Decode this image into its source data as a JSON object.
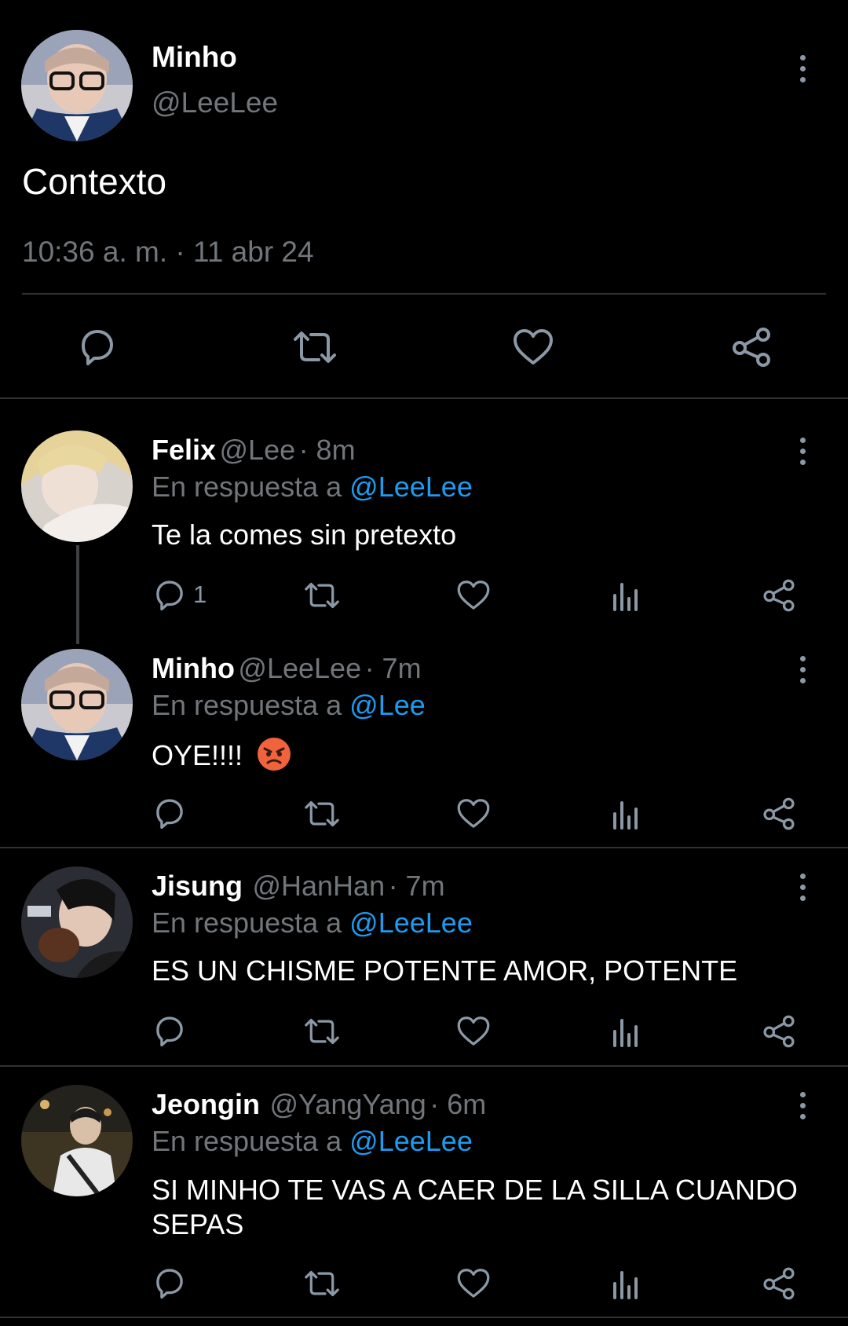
{
  "main_post": {
    "author_name": "Minho",
    "author_handle": "@LeeLee",
    "text": "Contexto",
    "timestamp": "10:36 a. m. · 11 abr 24"
  },
  "replies": [
    {
      "name": "Felix",
      "handle": "@Lee",
      "time": "· 8m",
      "reply_prefix": "En respuesta a",
      "reply_to": "@LeeLee",
      "text": "Te la comes sin pretexto",
      "reply_count": "1"
    },
    {
      "name": "Minho",
      "handle": "@LeeLee",
      "time": "· 7m",
      "reply_prefix": "En respuesta a",
      "reply_to": "@Lee",
      "text": "OYE!!!!",
      "emoji": "😡"
    },
    {
      "name": "Jisung",
      "handle": "@HanHan",
      "time": "· 7m",
      "reply_prefix": "En respuesta a",
      "reply_to": "@LeeLee",
      "text": "ES UN CHISME POTENTE AMOR, POTENTE"
    },
    {
      "name": "Jeongin",
      "handle": "@YangYang",
      "time": "· 6m",
      "reply_prefix": "En respuesta a",
      "reply_to": "@LeeLee",
      "text_line1": "SI MINHO TE VAS A CAER DE LA SILLA CUANDO",
      "text_line2": "SEPAS"
    }
  ],
  "colors": {
    "background": "#000000",
    "link": "#1d9bf0",
    "muted": "#71767b",
    "icon": "#8b98a5",
    "divider": "#2f3336"
  }
}
